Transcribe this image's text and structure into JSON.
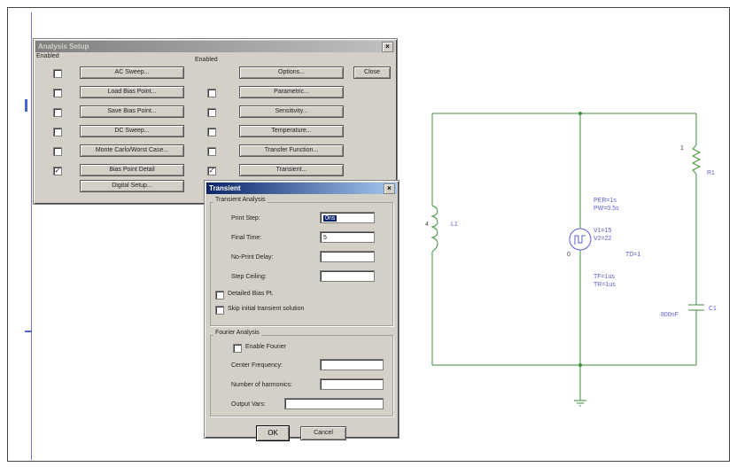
{
  "analysis_setup": {
    "title": "Analysis Setup",
    "enabled_header_left": "Enabled",
    "enabled_header_right": "Enabled",
    "close_label": "Close",
    "left_buttons": [
      {
        "label": "AC Sweep...",
        "checked": false
      },
      {
        "label": "Load Bias Point...",
        "checked": false
      },
      {
        "label": "Save Bias Point...",
        "checked": false
      },
      {
        "label": "DC Sweep...",
        "checked": false
      },
      {
        "label": "Monte Carlo/Worst Case...",
        "checked": false
      },
      {
        "label": "Bias Point Detail",
        "checked": true
      },
      {
        "label": "Digital Setup..."
      }
    ],
    "right_buttons": [
      {
        "label": "Options..."
      },
      {
        "label": "Parametric...",
        "checked": false
      },
      {
        "label": "Sensitivity...",
        "checked": false
      },
      {
        "label": "Temperature...",
        "checked": false
      },
      {
        "label": "Transfer Function...",
        "checked": false
      },
      {
        "label": "Transient...",
        "checked": true
      }
    ]
  },
  "transient": {
    "title": "Transient",
    "group_transient": "Transient Analysis",
    "fields": [
      {
        "label": "Print Step:",
        "value": "0ns"
      },
      {
        "label": "Final Time:",
        "value": "5"
      },
      {
        "label": "No-Print Delay:",
        "value": ""
      },
      {
        "label": "Step Ceiling:",
        "value": ""
      }
    ],
    "detailed_bias": "Detailed Bias Pt.",
    "skip_initial": "Skip initial transient solution",
    "group_fourier": "Fourier Analysis",
    "enable_fourier": "Enable Fourier",
    "fourier_fields": [
      {
        "label": "Center Frequency:",
        "value": ""
      },
      {
        "label": "Number of harmonics:",
        "value": ""
      },
      {
        "label": "Output Vars:",
        "value": ""
      }
    ],
    "ok_label": "OK",
    "cancel_label": "Cancel"
  },
  "circuit": {
    "r1_value": "1",
    "r1_name": "R1",
    "l1_value": "4",
    "l1_name": "L1",
    "c1_value": "800nF",
    "c1_name": "C1",
    "source_node": "0",
    "source_attrs": [
      "PER=1s",
      "PW=0.5s",
      "V1=15",
      "V2=22",
      "TD=1",
      "TF=1us",
      "TR=1us"
    ]
  },
  "colors": {
    "wire": "#3f8f3f",
    "label": "#5b5bd6",
    "titlebar": "#0a246a"
  }
}
